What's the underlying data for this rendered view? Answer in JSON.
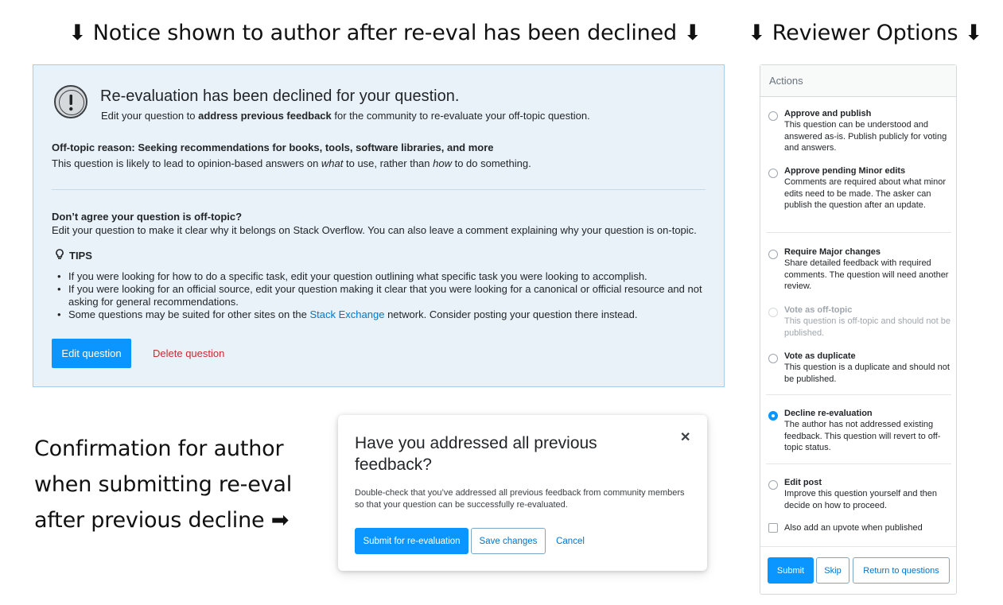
{
  "captions": {
    "notice": "⬇ Notice shown to author after re-eval has been declined ⬇",
    "reviewer": "⬇ Reviewer Options ⬇",
    "confirm_lines": [
      "Confirmation for author",
      "when submitting re-eval",
      "after previous decline ➡"
    ]
  },
  "notice": {
    "icon": "exclamation-circle-icon",
    "title": "Re-evaluation has been declined for your question.",
    "subtitle_pre": "Edit your question to ",
    "subtitle_bold": "address previous feedback",
    "subtitle_post": " for the community to re-evaluate your off-topic question.",
    "reason_title": "Off-topic reason: Seeking recommendations for books, tools, software libraries, and more",
    "reason_pre": "This question is likely to lead to opinion-based answers on ",
    "reason_em1": "what",
    "reason_mid": " to use, rather than ",
    "reason_em2": "how",
    "reason_post": " to do something.",
    "disagree_title": "Don’t agree your question is off-topic?",
    "disagree_text": "Edit your question to make it clear why it belongs on Stack Overflow. You can also leave a comment explaining why your question is on-topic.",
    "tips_icon": "lightbulb-icon",
    "tips_label": "TIPS",
    "tips": [
      "If you were looking for how to do a specific task, edit your question outlining what specific task you were looking to accomplish.",
      "If you were looking for an official source, edit your question making it clear that you were looking for a canonical or official resource and not asking for general recommendations."
    ],
    "tip3_pre": "Some questions may be suited for other sites on the ",
    "tip3_link": "Stack Exchange",
    "tip3_post": " network. Consider posting your question there instead.",
    "edit_button": "Edit question",
    "delete_button": "Delete question"
  },
  "reviewer": {
    "header": "Actions",
    "options": [
      {
        "title": "Approve and publish",
        "desc": "This question can be understood and answered as-is. Publish publicly for voting and answers."
      },
      {
        "title": "Approve pending Minor edits",
        "desc": "Comments are required about what minor edits need to be made. The asker can publish the question after an update."
      },
      {
        "title": "Require Major changes",
        "desc": "Share detailed feedback with required comments. The question will need another review."
      },
      {
        "title": "Vote as off-topic",
        "desc": "This question is off-topic and should not be published."
      },
      {
        "title": "Vote as duplicate",
        "desc": "This question is a duplicate and should not be published."
      },
      {
        "title": "Decline re-evaluation",
        "desc": "The author has not addressed existing feedback. This question will revert to off-topic status."
      },
      {
        "title": "Edit post",
        "desc": "Improve this question yourself and then decide on how to proceed."
      }
    ],
    "selected": "Decline re-evaluation",
    "disabled": "Vote as off-topic",
    "upvote_label": "Also add an upvote when published",
    "submit": "Submit",
    "skip": "Skip",
    "return": "Return to questions"
  },
  "modal": {
    "title": "Have you addressed all previous feedback?",
    "close_icon": "close-icon",
    "close_glyph": "✕",
    "body": "Double-check that you’ve addressed all previous feedback from community members so that your question can be successfully re-evaluated.",
    "submit": "Submit for re-evaluation",
    "save": "Save changes",
    "cancel": "Cancel"
  },
  "colors": {
    "primary": "#0a95ff",
    "notice_bg": "#e9f2f9",
    "danger": "#c22e32",
    "link": "#0077cc"
  }
}
